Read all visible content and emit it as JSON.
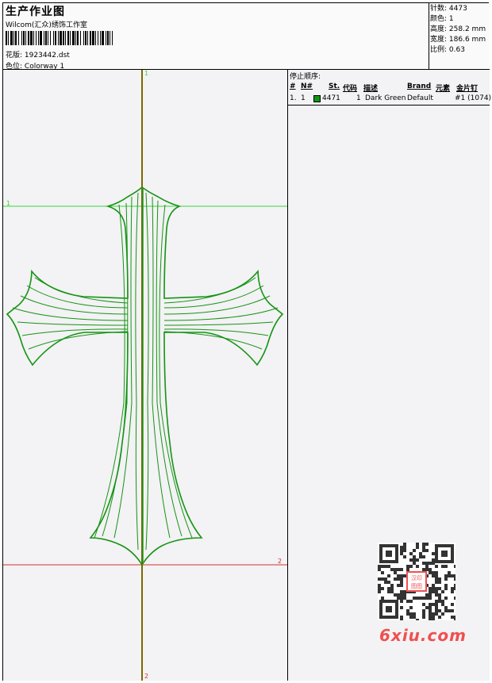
{
  "header": {
    "title": "生产作业图",
    "company": "Wilcom(汇众)绣饰工作室",
    "design_file_label": "花版:",
    "design_file": "1923442.dst",
    "colorway_label": "色位:",
    "colorway": "Colorway 1"
  },
  "stats": [
    {
      "label": "针数:",
      "value": "4473"
    },
    {
      "label": "颜色:",
      "value": "1"
    },
    {
      "label": "高度:",
      "value": "258.2 mm"
    },
    {
      "label": "宽度:",
      "value": "186.6 mm"
    },
    {
      "label": "比例:",
      "value": "0.63"
    }
  ],
  "design_markers": {
    "top": "1",
    "bottom": "2",
    "left": "1",
    "right": "2"
  },
  "stop_sequence": {
    "title": "停止顺序:",
    "columns": [
      "#",
      "N#",
      "St.",
      "代码",
      "描述",
      "Brand",
      "元素",
      "金片钉"
    ],
    "rows": [
      {
        "index": "1.",
        "needle": "1",
        "color": "#149414",
        "stitches": "4471",
        "code": "1",
        "description": "Dark Green",
        "brand": "Default",
        "element": "#1 (1074)"
      }
    ]
  },
  "watermark": {
    "brand": "6xiu.com",
    "qr_center_text": "汉印 图图",
    "qr_color": "#ef5050"
  },
  "colors": {
    "thread": "#149414",
    "guide_vertical": "#7a6a00",
    "guide_top": "#3ad63a",
    "guide_bottom": "#d43030"
  }
}
